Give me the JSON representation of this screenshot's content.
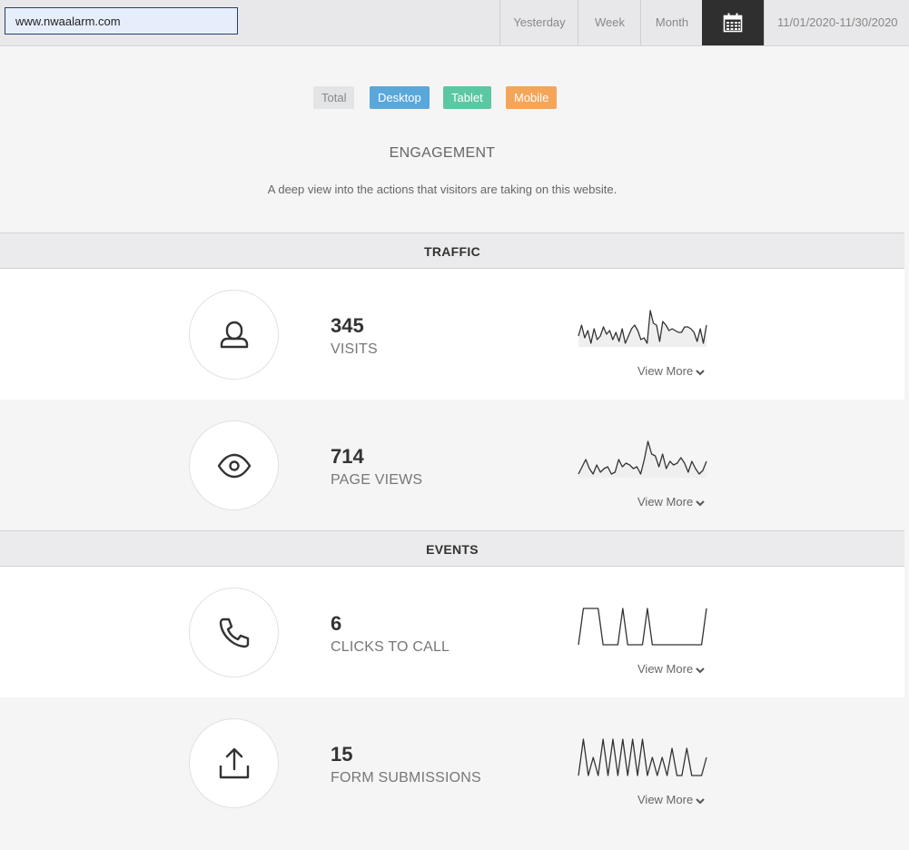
{
  "header": {
    "url_value": "www.nwaalarm.com",
    "ranges": [
      "Yesterday",
      "Week",
      "Month"
    ],
    "calendar_icon": "calendar-icon",
    "date_range": "11/01/2020-11/30/2020"
  },
  "filters": [
    "Total",
    "Desktop",
    "Tablet",
    "Mobile"
  ],
  "engagement": {
    "title": "ENGAGEMENT",
    "description": "A deep view into the actions that visitors are taking on this website."
  },
  "sections": {
    "traffic": "TRAFFIC",
    "events": "EVENTS"
  },
  "view_more_label": "View More",
  "metrics": [
    {
      "value": "345",
      "label": "VISITS",
      "icon": "person-icon",
      "sparkline": [
        6,
        12,
        5,
        9,
        2,
        10,
        4,
        6,
        11,
        7,
        9,
        4,
        8,
        3,
        10,
        2,
        6,
        10,
        12,
        9,
        4,
        5,
        2,
        20,
        13,
        12,
        3,
        14,
        12,
        9,
        10,
        9,
        8,
        8,
        11,
        11,
        10,
        8,
        3,
        10,
        2,
        12
      ],
      "sparkline_fill": true
    },
    {
      "value": "714",
      "label": "PAGE VIEWS",
      "icon": "eye-icon",
      "sparkline": [
        2,
        6,
        10,
        5,
        2,
        7,
        3,
        5,
        6,
        2,
        3,
        10,
        6,
        8,
        7,
        5,
        6,
        2,
        10,
        20,
        13,
        12,
        6,
        13,
        5,
        9,
        7,
        8,
        11,
        8,
        3,
        9,
        5,
        2,
        4,
        9
      ],
      "sparkline_fill": true
    },
    {
      "value": "6",
      "label": "CLICKS TO CALL",
      "icon": "phone-icon",
      "sparkline": [
        0,
        20,
        20,
        20,
        20,
        0,
        0,
        0,
        0,
        20,
        0,
        0,
        0,
        0,
        20,
        0,
        0,
        0,
        0,
        0,
        0,
        0,
        0,
        0,
        0,
        0,
        20
      ],
      "sparkline_fill": false
    },
    {
      "value": "15",
      "label": "FORM SUBMISSIONS",
      "icon": "upload-icon",
      "sparkline": [
        0,
        20,
        0,
        10,
        0,
        20,
        0,
        20,
        0,
        20,
        0,
        20,
        0,
        20,
        0,
        10,
        0,
        10,
        0,
        15,
        0,
        0,
        15,
        0,
        0,
        0,
        10
      ],
      "sparkline_fill": false
    }
  ]
}
